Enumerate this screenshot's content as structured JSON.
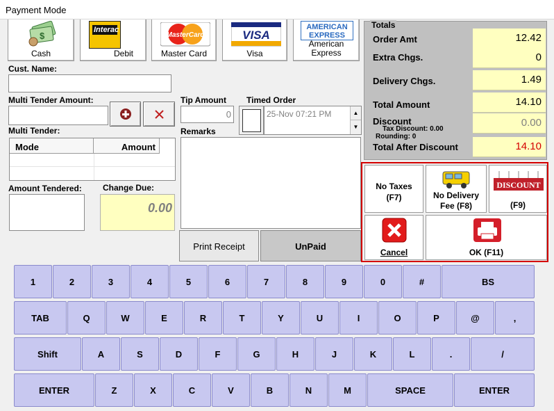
{
  "window": {
    "title": "Payment Mode"
  },
  "payment_methods": [
    {
      "label": "Cash",
      "icon": "cash-icon"
    },
    {
      "label": "Debit",
      "icon": "interac-icon",
      "logo_text": "Interac"
    },
    {
      "label": "Master Card",
      "icon": "mastercard-icon",
      "logo_text": "MasterCard"
    },
    {
      "label": "Visa",
      "icon": "visa-icon",
      "logo_text": "VISA"
    },
    {
      "label": "American Express",
      "icon": "amex-icon",
      "logo_text": "AMERICAN EXPRESS"
    }
  ],
  "customer": {
    "label": "Cust. Name:",
    "value": ""
  },
  "multi_tender": {
    "amount_label": "Multi Tender Amount:",
    "amount_value": "",
    "list_label": "Multi Tender:",
    "columns": [
      "Mode",
      "Amount"
    ],
    "rows": []
  },
  "tip": {
    "label": "Tip Amount",
    "value": "0"
  },
  "timed_order": {
    "label": "Timed Order",
    "value": "25-Nov 07:21 PM",
    "checked": false
  },
  "remarks": {
    "label": "Remarks",
    "value": ""
  },
  "amount_tendered": {
    "label": "Amount Tendered:",
    "value": ""
  },
  "change_due": {
    "label": "Change Due:",
    "value": "0.00"
  },
  "buttons": {
    "print_receipt": "Print Receipt",
    "unpaid": "UnPaid"
  },
  "totals": {
    "title": "Totals",
    "order_amt": {
      "label": "Order Amt",
      "value": "12.42"
    },
    "extra_chgs": {
      "label": "Extra Chgs.",
      "value": "0"
    },
    "delivery_chgs": {
      "label": "Delivery Chgs.",
      "value": "1.49"
    },
    "total_amount": {
      "label": "Total Amount",
      "value": "14.10"
    },
    "discount": {
      "label": "Discount",
      "value": "0.00",
      "tax_discount": "Tax Discount: 0.00",
      "rounding": "Rounding: 0"
    },
    "total_after_discount": {
      "label": "Total After Discount",
      "value": "14.10"
    }
  },
  "actions": {
    "no_taxes": {
      "line1": "No Taxes",
      "line2": "(F7)"
    },
    "no_delivery": {
      "line1": "No Delivery",
      "line2": "Fee (F8)"
    },
    "discount": {
      "label": "(F9)",
      "banner": "DISCOUNT"
    },
    "cancel": {
      "label": "Cancel"
    },
    "ok": {
      "label": "OK (F11)"
    }
  },
  "colors": {
    "key_fill": "#c8c8f0",
    "total_yellow": "#ffffc0",
    "accent_red": "#d40000"
  },
  "keyboard": {
    "rows": [
      [
        "1",
        "2",
        "3",
        "4",
        "5",
        "6",
        "7",
        "8",
        "9",
        "0",
        "#",
        "BS"
      ],
      [
        "TAB",
        "Q",
        "W",
        "E",
        "R",
        "T",
        "Y",
        "U",
        "I",
        "O",
        "P",
        "@",
        ","
      ],
      [
        "Shift",
        "A",
        "S",
        "D",
        "F",
        "G",
        "H",
        "J",
        "K",
        "L",
        ".",
        "/"
      ],
      [
        "ENTER",
        "Z",
        "X",
        "C",
        "V",
        "B",
        "N",
        "M",
        "SPACE",
        "ENTER"
      ]
    ]
  }
}
